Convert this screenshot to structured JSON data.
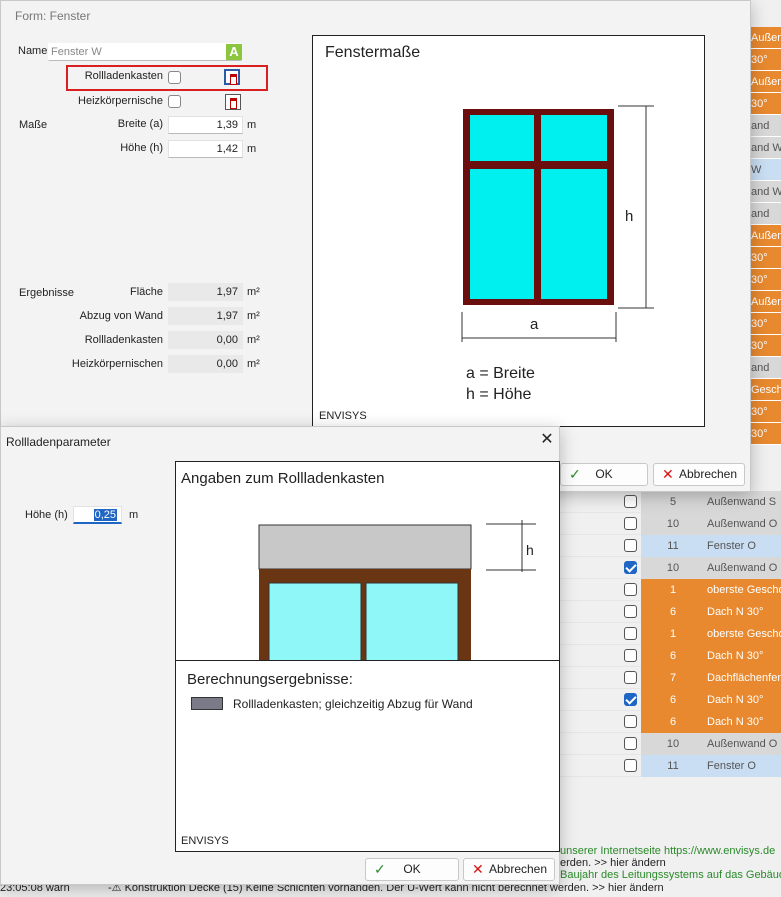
{
  "background_grid": {
    "right_column": [
      {
        "text": "Außenfen",
        "style": "o"
      },
      {
        "text": "30°",
        "style": "o"
      },
      {
        "text": "Außenfen",
        "style": "o"
      },
      {
        "text": "30°",
        "style": "o"
      },
      {
        "text": "and",
        "style": "g"
      },
      {
        "text": "and W",
        "style": "g"
      },
      {
        "text": "W",
        "style": "b"
      },
      {
        "text": "and W",
        "style": "g"
      },
      {
        "text": "and",
        "style": "g"
      },
      {
        "text": "Außenfen",
        "style": "o"
      },
      {
        "text": "30°",
        "style": "o"
      },
      {
        "text": "30°",
        "style": "o"
      },
      {
        "text": "Außenfen",
        "style": "o"
      },
      {
        "text": "30°",
        "style": "o"
      },
      {
        "text": "30°",
        "style": "o"
      },
      {
        "text": "and",
        "style": "g"
      },
      {
        "text": "Gescho",
        "style": "o"
      },
      {
        "text": "30°",
        "style": "o"
      },
      {
        "text": "30°",
        "style": "o"
      }
    ],
    "rows": [
      {
        "checked": false,
        "num": "5",
        "type": "Außenwand S",
        "style": "g"
      },
      {
        "checked": false,
        "num": "10",
        "type": "Außenwand O",
        "style": "g"
      },
      {
        "checked": false,
        "num": "11",
        "type": "Fenster O",
        "style": "b"
      },
      {
        "checked": true,
        "num": "10",
        "type": "Außenwand O",
        "style": "g"
      },
      {
        "checked": false,
        "num": "1",
        "type": "oberste Gescho",
        "style": "o"
      },
      {
        "checked": false,
        "num": "6",
        "type": "Dach N 30°",
        "style": "o"
      },
      {
        "checked": false,
        "num": "1",
        "type": "oberste Gescho",
        "style": "o"
      },
      {
        "checked": false,
        "num": "6",
        "type": "Dach N 30°",
        "style": "o"
      },
      {
        "checked": false,
        "num": "7",
        "type": "Dachflächenfen",
        "style": "o"
      },
      {
        "checked": true,
        "num": "6",
        "type": "Dach N 30°",
        "style": "o"
      },
      {
        "checked": false,
        "num": "6",
        "type": "Dach N 30°",
        "style": "o"
      },
      {
        "checked": false,
        "num": "10",
        "type": "Außenwand O",
        "style": "g"
      },
      {
        "checked": false,
        "num": "11",
        "type": "Fenster O",
        "style": "b"
      }
    ]
  },
  "log": {
    "line1": "unserer Internetseite https://www.envisys.de",
    "line2": "erden. >> hier ändern",
    "line3": "Baujahr des Leitungssystems auf das Gebäude",
    "line4_time": "23:05:08 warn",
    "line4_text": "-⚠ Konstruktion  Decke (15)  Keine Schichten vorhanden. Der U-Wert kann nicht berechnet werden. >> hier ändern"
  },
  "fenster_dialog": {
    "title": "Form: Fenster",
    "name_label": "Name",
    "name_value": "Fenster W",
    "name_badge": "A",
    "rollladen_label": "Rollladenkasten",
    "heizkoerper_label": "Heizkörpernische",
    "masse_label": "Maße",
    "breite_label": "Breite (a)",
    "breite_value": "1,39",
    "breite_unit": "m",
    "hoehe_label": "Höhe (h)",
    "hoehe_value": "1,42",
    "hoehe_unit": "m",
    "ergebnisse_label": "Ergebnisse",
    "flaeche_label": "Fläche",
    "flaeche_value": "1,97",
    "abzug_label": "Abzug von Wand",
    "abzug_value": "1,97",
    "rollladenkasten_label": "Rollladenkasten",
    "rollladenkasten_value": "0,00",
    "heizkoerpernischen_label": "Heizkörpernischen",
    "heizkoerpernischen_value": "0,00",
    "area_unit": "m²",
    "diagram_title": "Fenstermaße",
    "dim_h": "h",
    "dim_a": "a",
    "legend_a": "a = Breite",
    "legend_h": "h = Höhe",
    "brand": "ENVISYS",
    "ok_label": "OK",
    "cancel_label": "Abbrechen"
  },
  "roll_dialog": {
    "title": "Rollladenparameter",
    "close_glyph": "✕",
    "hoehe_label": "Höhe (h)",
    "hoehe_value": "0,25",
    "hoehe_unit": "m",
    "diagram_title": "Angaben zum Rollladenkasten",
    "dim_h": "h",
    "results_title": "Berechnungsergebnisse:",
    "results_legend": "Rollladenkasten; gleichzeitig Abzug für Wand",
    "brand": "ENVISYS",
    "ok_label": "OK",
    "cancel_label": "Abbrechen"
  },
  "colors": {
    "accent_orange": "#e8892f",
    "glass_cyan": "#00f0f0",
    "frame_darkred": "#6b0e0e",
    "frame_brown": "#6a3512",
    "highlight_red": "#d91f1f",
    "selection_blue": "#1e65c4",
    "badge_green": "#8cc63f"
  }
}
